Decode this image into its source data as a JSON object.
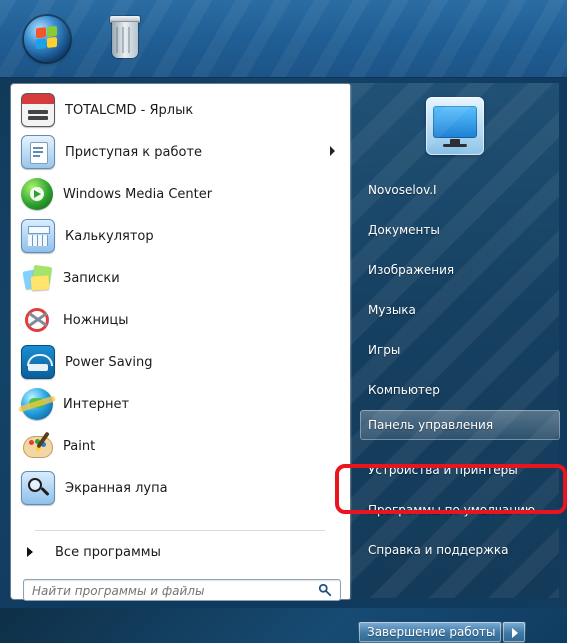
{
  "taskbar": {
    "start_icon": "windows-orb-icon",
    "desktop_icon": "recycle-bin-icon"
  },
  "start_menu": {
    "left_items": [
      {
        "label": "TOTALCMD - Ярлык",
        "icon": "total-commander-icon",
        "has_submenu": false
      },
      {
        "label": "Приступая к работе",
        "icon": "getting-started-icon",
        "has_submenu": true
      },
      {
        "label": "Windows Media Center",
        "icon": "media-center-icon",
        "has_submenu": false
      },
      {
        "label": "Калькулятор",
        "icon": "calculator-icon",
        "has_submenu": false
      },
      {
        "label": "Записки",
        "icon": "sticky-notes-icon",
        "has_submenu": false
      },
      {
        "label": "Ножницы",
        "icon": "scissors-icon",
        "has_submenu": false
      },
      {
        "label": "Power Saving",
        "icon": "energy-star-icon",
        "has_submenu": false
      },
      {
        "label": "Интернет",
        "icon": "internet-globe-icon",
        "has_submenu": false
      },
      {
        "label": "Paint",
        "icon": "paint-palette-icon",
        "has_submenu": false
      },
      {
        "label": "Экранная лупа",
        "icon": "magnifier-icon",
        "has_submenu": false
      }
    ],
    "all_programs_label": "Все программы",
    "search_placeholder": "Найти программы и файлы",
    "right_items": [
      {
        "label": "Novoselov.I"
      },
      {
        "label": "Документы"
      },
      {
        "label": "Изображения"
      },
      {
        "label": "Музыка"
      },
      {
        "label": "Игры"
      },
      {
        "label": "Компьютер"
      },
      {
        "label": "Панель управления",
        "selected": true
      },
      {
        "label": "Устройства и принтеры"
      },
      {
        "label": "Программы по умолчанию"
      },
      {
        "label": "Справка и поддержка"
      }
    ],
    "shutdown_label": "Завершение работы"
  },
  "colors": {
    "highlight_outline": "#e8141e"
  }
}
